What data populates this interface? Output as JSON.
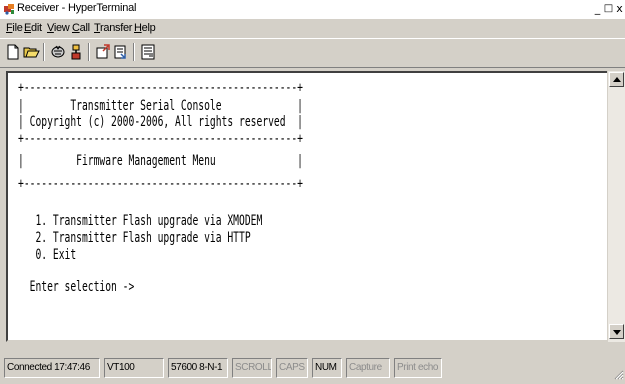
{
  "window": {
    "title": "Receiver - HyperTerminal",
    "controls": {
      "minimize": "_",
      "maximize": "□",
      "close": "x"
    }
  },
  "menu": {
    "items": [
      {
        "key": "F",
        "rest": "ile"
      },
      {
        "key": "E",
        "rest": "dit"
      },
      {
        "key": "V",
        "rest": "iew"
      },
      {
        "key": "C",
        "rest": "all"
      },
      {
        "key": "T",
        "rest": "ransfer"
      },
      {
        "key": "H",
        "rest": "elp"
      }
    ]
  },
  "toolbar": {
    "buttons": [
      "new-connection-icon",
      "open-icon",
      "disconnect-icon",
      "connect-icon",
      "send-icon",
      "receive-icon",
      "properties-icon"
    ]
  },
  "terminal": {
    "lines": [
      "+-----------------------------------------------+",
      "|        Transmitter Serial Console             |",
      "| Copyright (c) 2000-2006, All rights reserved  |",
      "+-----------------------------------------------+",
      "|         Firmware Management Menu              |",
      "+-----------------------------------------------+",
      "",
      "   1. Transmitter Flash upgrade via XMODEM",
      "   2. Transmitter Flash upgrade via HTTP",
      "   0. Exit",
      "",
      "  Enter selection ->"
    ]
  },
  "statusbar": {
    "connection": "Connected 17:47:46",
    "emulation": "VT100",
    "port": "57600 8-N-1",
    "scroll": "SCROLL",
    "caps": "CAPS",
    "num": "NUM",
    "capture": "Capture",
    "print_echo": "Print echo"
  }
}
